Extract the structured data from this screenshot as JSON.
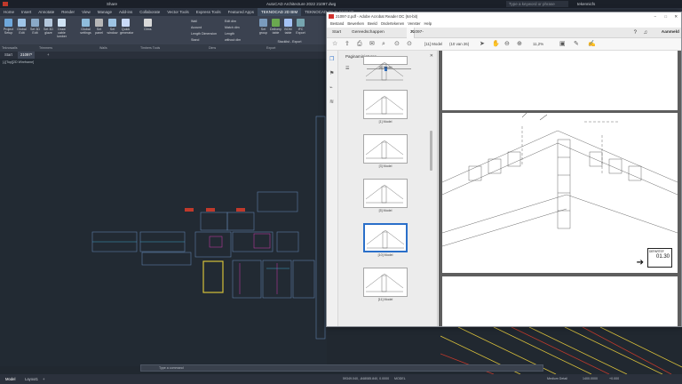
{
  "acad": {
    "title_left": "Share",
    "title_center": "AutoCAD Architecture 2022   21097.dwg",
    "search_placeholder": "Type a keyword or phrase",
    "user": "tekennicfs",
    "menu": [
      "Home",
      "Insert",
      "Annotate",
      "Render",
      "View",
      "Manage",
      "Add-ins",
      "Collaborate",
      "Vector Tools",
      "Express Tools",
      "Featured Apps",
      "TEKNOCAD 2D BIM",
      "TEKNOCAD 3D FLEXICAD"
    ],
    "menu_active": "TEKNOCAD 2D BIM",
    "ribbon": [
      {
        "label": "Project Setup",
        "color": "#6fa8dc"
      },
      {
        "label": "Global Edit",
        "color": "#9fc5e8"
      },
      {
        "label": "Set 3D Edit",
        "color": "#8aa9c7"
      },
      {
        "label": "Set 3D glaze",
        "color": "#b4c7dc"
      },
      {
        "label": "Draw cable lumber",
        "color": "#cfe2f3"
      },
      {
        "label": "Global settings",
        "color": "#8fbcdb"
      },
      {
        "label": "Set panel",
        "color": "#b7b7b7"
      },
      {
        "label": "Set window",
        "color": "#9ec4e4"
      },
      {
        "label": "Quick generator",
        "color": "#c9daf8"
      },
      {
        "label": "Dims",
        "color": "#d9d9d9"
      }
    ],
    "ribbon_small": [
      "Wall",
      "Acound",
      "Length Dimension",
      "Stand",
      "Edit dim",
      "Match dim",
      "Length",
      "without dim"
    ],
    "ribbon_right": [
      "Set group",
      "Delivery table",
      "BOM table",
      "IFC Export",
      "Stacklist - Export"
    ],
    "groups": [
      "Teknowalls",
      "Trimmers",
      "Walls",
      "Timbers Tools",
      "Dims",
      "Export"
    ],
    "doc_tabs": [
      "Start",
      "21097*"
    ],
    "view_label": "[-][Top][2D Wireframe]",
    "layout_tabs": [
      "Model",
      "Layout1"
    ],
    "cmd_placeholder": "Type a command",
    "status_coords": "59349.040, -848085.840, 0.0000",
    "status_mode": "MODEL",
    "status_scale": "1400.0000",
    "status_detail": "Medium Detail",
    "status_val": "+0.000"
  },
  "acro": {
    "title": "21097-2.pdf - Adobe Acrobat Reader DC (64-bit)",
    "menu": [
      "Bestand",
      "Bewerken",
      "Beeld",
      "Ondertekenen",
      "Venster",
      "Help"
    ],
    "tabs": [
      "Start",
      "Gereedschappen",
      "21097-2.pdf"
    ],
    "page_label": "[11] Model",
    "page_count": "(10 van 26)",
    "zoom": "11,2%",
    "sign_in": "Aanmeld",
    "thumb_header": "Paginaminiaturen",
    "thumbs": [
      "[8] Model",
      "[1] Model",
      "[3] Model",
      "[5] Model",
      "[10] Model",
      "[11] Model"
    ],
    "selected_thumb": 4,
    "titleblock_label": "DEPARTEF",
    "titleblock_num": "01.30"
  }
}
